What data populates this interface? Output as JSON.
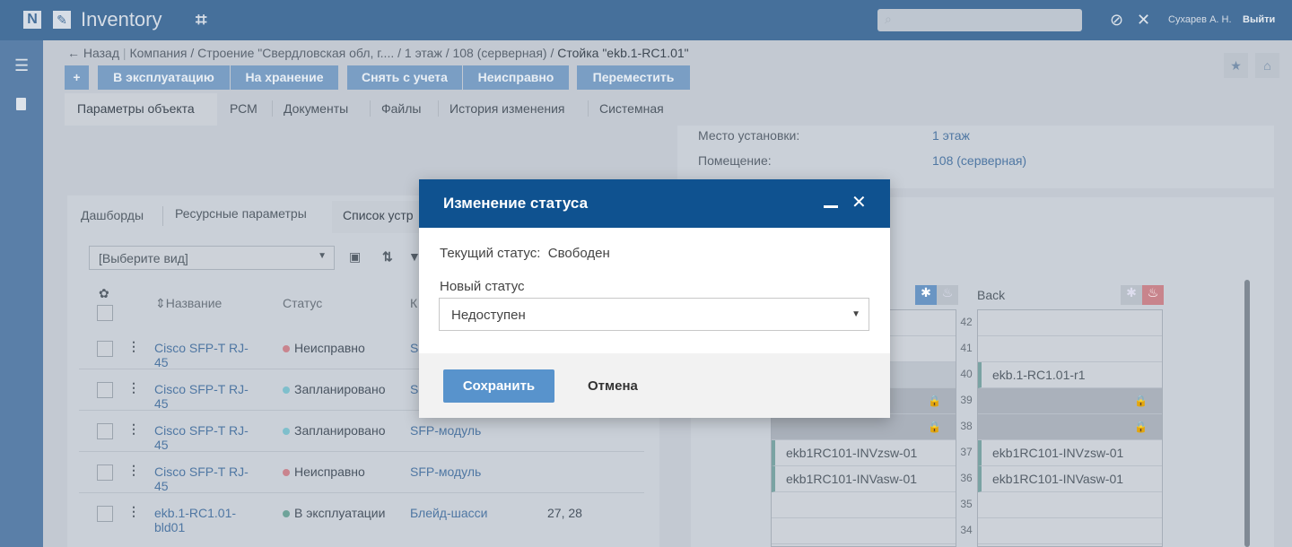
{
  "app": {
    "title": "Inventory",
    "logo_letter": "N",
    "user": "Сухарев А. Н.",
    "logout": "Выйти"
  },
  "breadcrumb": {
    "back": "← Назад",
    "path": "Компания / Строение \"Свердловская обл, г.... / 1 этаж / 108 (серверная) / ",
    "current": "Стойка \"ekb.1-RC1.01\""
  },
  "actions": [
    "В эксплуатацию",
    "На хранение",
    "Снять с учета",
    "Неисправно",
    "Переместить"
  ],
  "tabs": [
    "Параметры объекта",
    "РСМ",
    "Документы",
    "Файлы",
    "История изменения",
    "Системная"
  ],
  "info": {
    "location_label": "Место установки:",
    "location_value": "1 этаж",
    "room_label": "Помещение:",
    "room_value": "108 (серверная)"
  },
  "subtabs": [
    "Дашборды",
    "Ресурсные параметры",
    "Список устр"
  ],
  "view_select": {
    "value": "[Выберите вид]"
  },
  "table": {
    "headers": [
      "Название",
      "Статус",
      "К"
    ],
    "rows": [
      {
        "name": "Cisco SFP-T RJ-45",
        "status": "Неисправно",
        "status_color": "#c9848e",
        "type": "S",
        "extra": ""
      },
      {
        "name": "Cisco SFP-T RJ-45",
        "status": "Запланировано",
        "status_color": "#7fbfcc",
        "type": "S",
        "extra": ""
      },
      {
        "name": "Cisco SFP-T RJ-45",
        "status": "Запланировано",
        "status_color": "#7fbfcc",
        "type": "SFP-модуль",
        "extra": ""
      },
      {
        "name": "Cisco SFP-T RJ-45",
        "status": "Неисправно",
        "status_color": "#c9848e",
        "type": "SFP-модуль",
        "extra": ""
      },
      {
        "name": "ekb.1-RC1.01-bld01",
        "status": "В эксплуатации",
        "status_color": "#6fa39a",
        "type": "Блейд-шасси",
        "extra": "27, 28"
      }
    ]
  },
  "rack": {
    "back_label": "Back",
    "units": [
      "42",
      "41",
      "40",
      "39",
      "38",
      "37",
      "36",
      "35",
      "34"
    ],
    "front": [
      "",
      "",
      "",
      "",
      "",
      "ekb1RC101-INVzsw-01",
      "ekb1RC101-INVasw-01",
      "",
      ""
    ],
    "back": [
      "",
      "",
      "ekb.1-RC1.01-r1",
      "",
      "",
      "ekb1RC101-INVzsw-01",
      "ekb1RC101-INVasw-01",
      "",
      ""
    ]
  },
  "modal": {
    "title": "Изменение статуса",
    "current_label": "Текущий статус:",
    "current_value": "Свободен",
    "new_label": "Новый статус",
    "new_value": "Недоступен",
    "save": "Сохранить",
    "cancel": "Отмена"
  }
}
